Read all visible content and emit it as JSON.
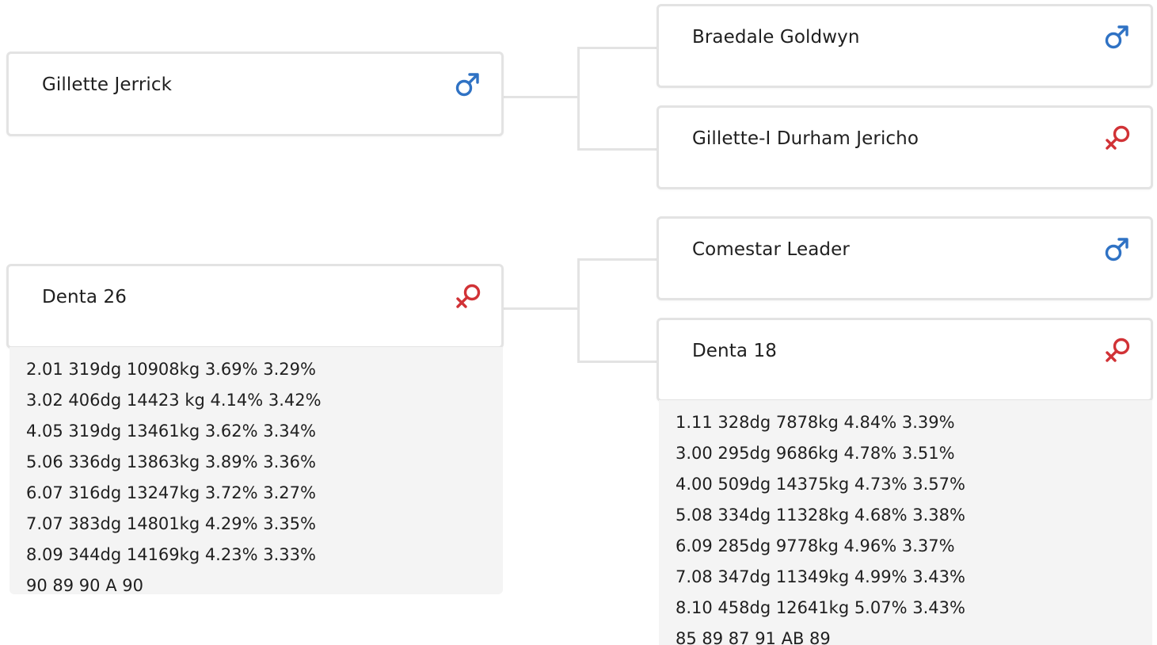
{
  "colors": {
    "male": "#2f72c4",
    "female": "#d13236",
    "border": "#e3e3e3",
    "stats_bg": "#f4f4f4"
  },
  "parents": [
    {
      "name": "Gillette Jerrick",
      "sex": "male",
      "sex_icon": "male-symbol-icon"
    },
    {
      "name": "Denta 26",
      "sex": "female",
      "sex_icon": "female-symbol-icon",
      "stats": [
        "2.01 319dg 10908kg 3.69% 3.29%",
        "3.02 406dg 14423 kg 4.14% 3.42%",
        "4.05 319dg 13461kg 3.62% 3.34%",
        "5.06 336dg 13863kg 3.89% 3.36%",
        "6.07 316dg 13247kg 3.72% 3.27%",
        "7.07 383dg 14801kg 4.29% 3.35%",
        "8.09 344dg 14169kg 4.23% 3.33%",
        "90 89 90 A 90"
      ]
    }
  ],
  "grandparents": [
    {
      "name": "Braedale Goldwyn",
      "sex": "male",
      "sex_icon": "male-symbol-icon"
    },
    {
      "name": "Gillette-I Durham Jericho",
      "sex": "female",
      "sex_icon": "female-symbol-icon"
    },
    {
      "name": "Comestar Leader",
      "sex": "male",
      "sex_icon": "male-symbol-icon"
    },
    {
      "name": "Denta 18",
      "sex": "female",
      "sex_icon": "female-symbol-icon",
      "stats": [
        "1.11 328dg 7878kg 4.84% 3.39%",
        "3.00 295dg 9686kg 4.78% 3.51%",
        "4.00 509dg 14375kg 4.73% 3.57%",
        "5.08 334dg 11328kg 4.68% 3.38%",
        "6.09 285dg 9778kg 4.96% 3.37%",
        "7.08 347dg 11349kg 4.99% 3.43%",
        "8.10 458dg 12641kg 5.07% 3.43%",
        "85 89 87 91 AB 89"
      ]
    }
  ]
}
